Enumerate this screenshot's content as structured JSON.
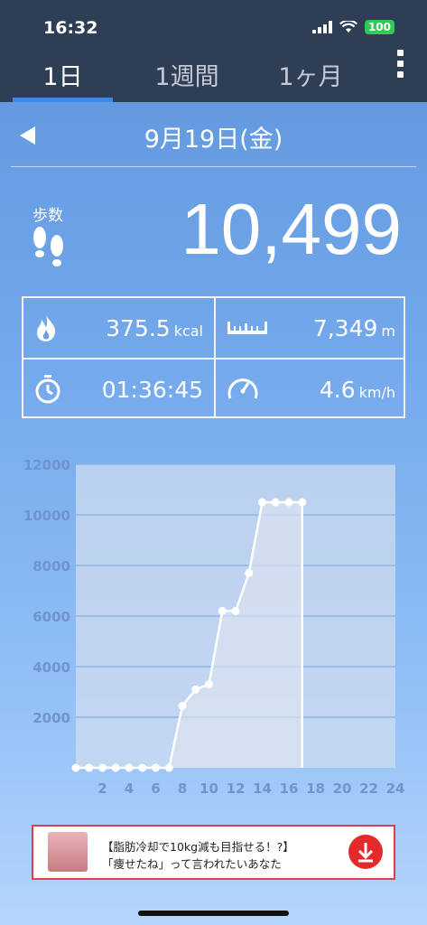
{
  "status_bar": {
    "time": "16:32",
    "battery": "100"
  },
  "tabs": [
    {
      "label": "1日",
      "active": true
    },
    {
      "label": "1週間",
      "active": false
    },
    {
      "label": "1ヶ月",
      "active": false
    }
  ],
  "date_nav": {
    "date": "9月19日(金)"
  },
  "steps": {
    "label": "歩数",
    "value": "10,499"
  },
  "stats": {
    "calories": {
      "value": "375.5",
      "unit": "kcal"
    },
    "distance": {
      "value": "7,349",
      "unit": "m"
    },
    "duration": {
      "value": "01:36:45"
    },
    "speed": {
      "value": "4.6",
      "unit": "km/h"
    }
  },
  "chart_data": {
    "type": "line",
    "xlim": [
      0,
      24
    ],
    "ylim": [
      0,
      12000
    ],
    "xticks": [
      2,
      4,
      6,
      8,
      10,
      12,
      14,
      16,
      18,
      20,
      22,
      24
    ],
    "yticks": [
      2000,
      4000,
      6000,
      8000,
      10000,
      12000
    ],
    "x": [
      0,
      1,
      2,
      3,
      4,
      5,
      6,
      7,
      8,
      9,
      10,
      11,
      12,
      13,
      14,
      15,
      16,
      17
    ],
    "y": [
      0,
      0,
      0,
      0,
      0,
      0,
      0,
      0,
      2450,
      3100,
      3300,
      6200,
      6200,
      7700,
      10499,
      10499,
      10499,
      10499
    ],
    "colors": {
      "line": "#ffffff",
      "fill": "#dfe6f0",
      "plot_bg": "#cfdcef",
      "grid": "#8fb4e6",
      "tick_label": "#6f94cf"
    }
  },
  "ad": {
    "line1": "【脂肪冷却で10kg減も目指せる！?】",
    "line2": "「痩せたね」って言われたいあなた",
    "border_color": "#e23c53"
  }
}
